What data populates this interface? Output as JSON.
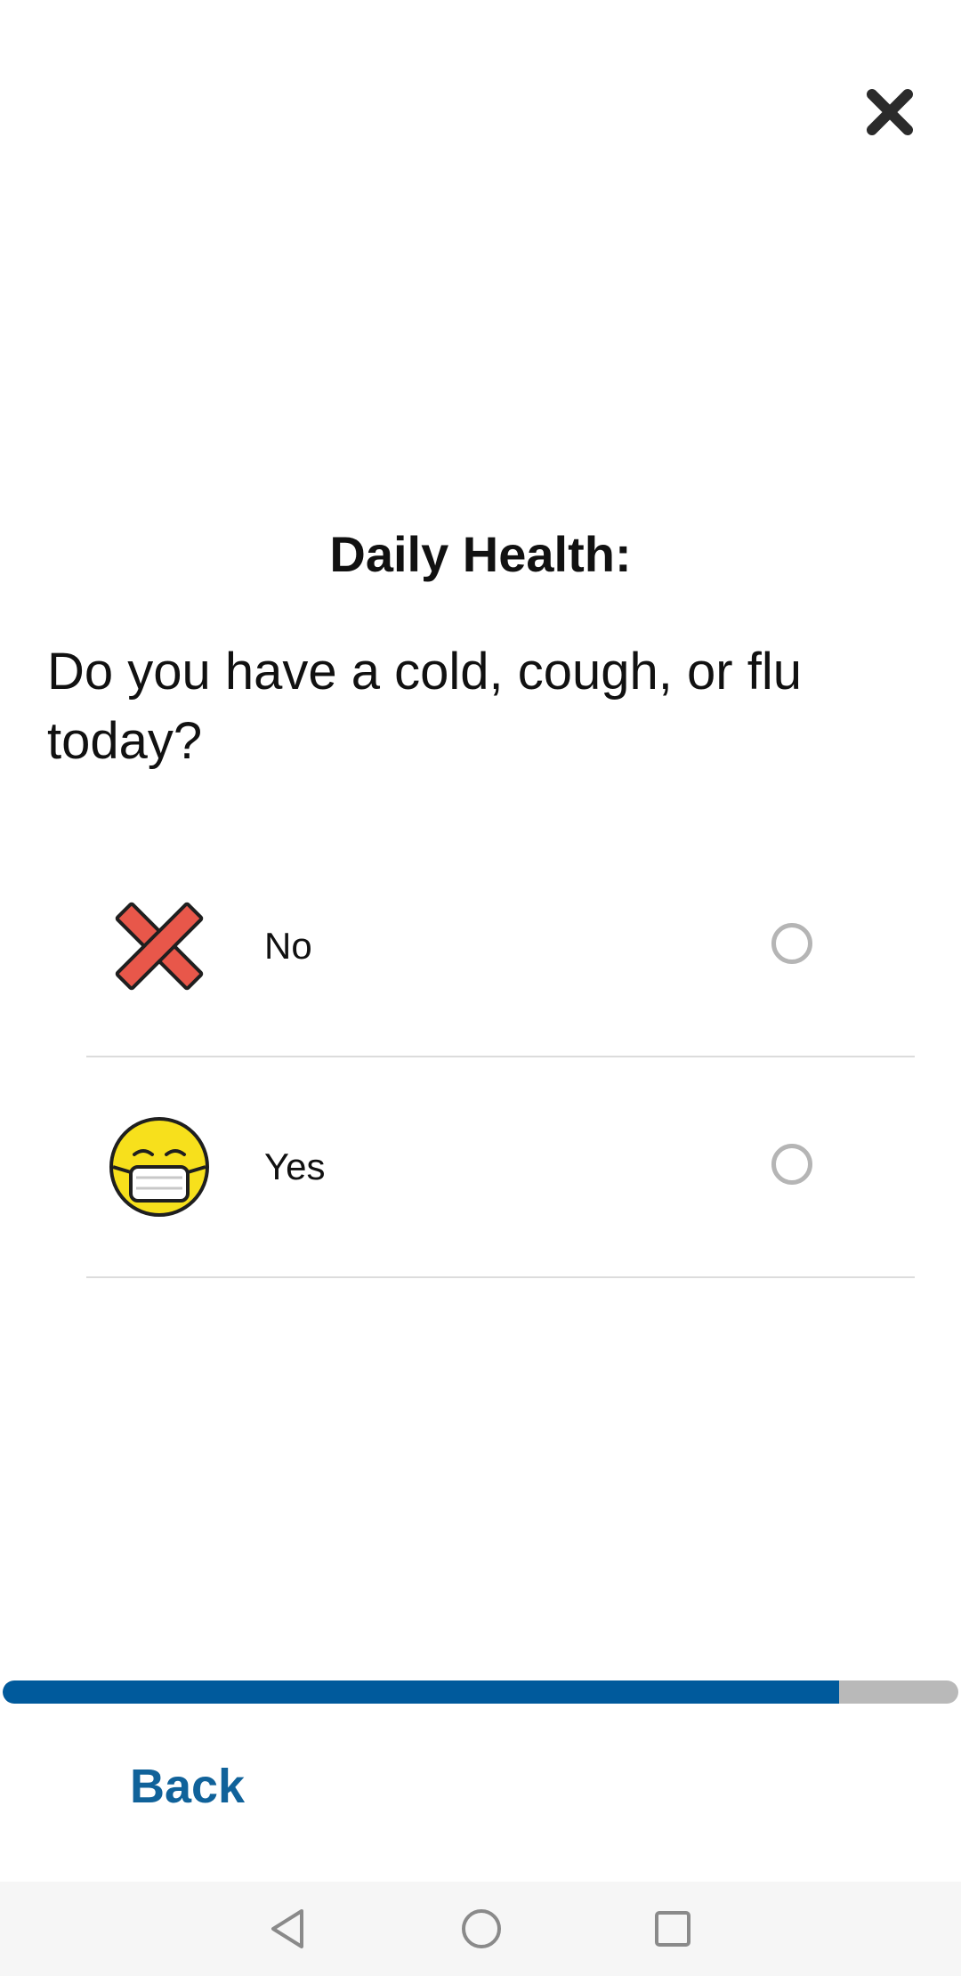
{
  "header": {
    "close_icon": "close-icon"
  },
  "survey": {
    "section_title": "Daily Health:",
    "question": "Do you have a cold, cough, or flu today?",
    "options": [
      {
        "label": "No",
        "icon": "red-x-icon",
        "selected": false
      },
      {
        "label": "Yes",
        "icon": "face-with-mask-icon",
        "selected": false
      }
    ]
  },
  "progress": {
    "fraction": 0.875,
    "fill_color": "#005a9c",
    "track_color": "#b9b9b9"
  },
  "footer": {
    "back_label": "Back"
  },
  "system_nav": {
    "back_icon": "nav-back-icon",
    "home_icon": "nav-home-icon",
    "recents_icon": "nav-recents-icon"
  }
}
